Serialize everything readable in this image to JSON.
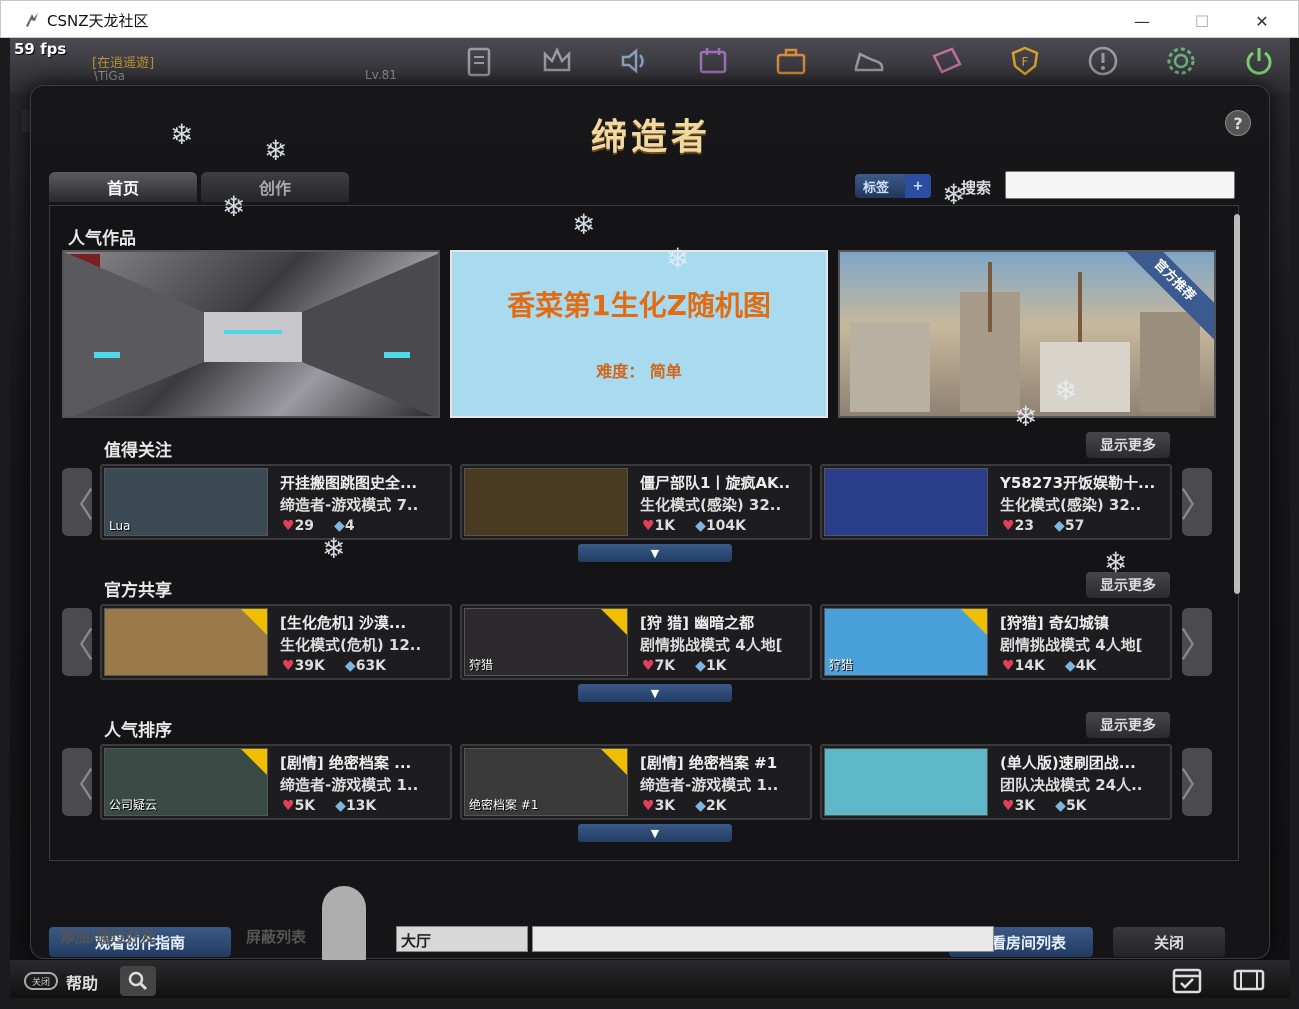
{
  "window": {
    "title": "CSNZ天龙社区",
    "minimize": "—",
    "maximize": "☐",
    "close": "✕"
  },
  "hud": {
    "fps": "59 fps",
    "status_tag": "[在逍遥遊]",
    "nickname": "\\TiGa",
    "level": "Lv.81"
  },
  "modal": {
    "title": "缔造者",
    "help": "?",
    "tabs": [
      {
        "label": "首页"
      },
      {
        "label": "创作"
      }
    ],
    "tag_button": "标签",
    "tag_plus": "+",
    "search_label": "搜索",
    "search_value": "",
    "popular": {
      "title": "人气作品",
      "featured_center_title": "香菜第1生化Z随机图",
      "featured_center_sub": "难度： 简单",
      "featured_right_ribbon": "官方推荐"
    },
    "sections": [
      {
        "title": "值得关注",
        "more": "显示更多",
        "cards": [
          {
            "title": "开挂搬图跳图史全...",
            "mode": "缔造者-游戏模式 7..",
            "likes": "29",
            "forks": "4",
            "thumb_label": "Lua",
            "thumb_color": "#3b4a55",
            "badge": false
          },
          {
            "title": "僵尸部队1丨旋疯AK..",
            "mode": "生化模式(感染) 32..",
            "likes": "1K",
            "forks": "104K",
            "thumb_label": "",
            "thumb_color": "#4a3a22",
            "badge": false
          },
          {
            "title": "Y58273开饭娱勒十...",
            "mode": "生化模式(感染) 32..",
            "likes": "23",
            "forks": "57",
            "thumb_label": "",
            "thumb_color": "#2a3e8a",
            "badge": false
          }
        ]
      },
      {
        "title": "官方共享",
        "more": "显示更多",
        "cards": [
          {
            "title": "[生化危机] 沙漠...",
            "mode": "生化模式(危机) 12..",
            "likes": "39K",
            "forks": "63K",
            "thumb_label": "",
            "thumb_color": "#9b7a4a",
            "badge": true
          },
          {
            "title": "[狩 猎] 幽暗之都",
            "mode": "剧情挑战模式 4人地[",
            "likes": "7K",
            "forks": "1K",
            "thumb_label": "狩猎",
            "thumb_color": "#2c2a2c",
            "badge": true
          },
          {
            "title": "[狩猎] 奇幻城镇",
            "mode": "剧情挑战模式 4人地[",
            "likes": "14K",
            "forks": "4K",
            "thumb_label": "狩猎",
            "thumb_color": "#4aa0d8",
            "badge": true
          }
        ]
      },
      {
        "title": "人气排序",
        "more": "显示更多",
        "cards": [
          {
            "title": "[剧情] 绝密档案 ...",
            "mode": "缔造者-游戏模式 1..",
            "likes": "5K",
            "forks": "13K",
            "thumb_label": "公司疑云",
            "thumb_color": "#3a4a44",
            "badge": true
          },
          {
            "title": "[剧情] 绝密档案 #1",
            "mode": "缔造者-游戏模式 1..",
            "likes": "3K",
            "forks": "2K",
            "thumb_label": "绝密档案 #1",
            "thumb_color": "#3a3a3a",
            "badge": true
          },
          {
            "title": "(单人版)速刷团战...",
            "mode": "团队决战模式 24人..",
            "likes": "3K",
            "forks": "5K",
            "thumb_label": "",
            "thumb_color": "#5fb8c8",
            "badge": false
          }
        ]
      }
    ],
    "guide_button": "观看创作指南",
    "roomlist_button": "查看房间列表",
    "close_button": "关闭"
  },
  "lobby": {
    "add_friend": "添加/通过好友",
    "block_list": "屏蔽列表",
    "channel": "大厅",
    "chat_value": ""
  },
  "bottombar": {
    "help_pill": "关闭",
    "help": "帮助"
  },
  "icons": {
    "top": [
      "clipboard-icon",
      "crown-icon",
      "speaker-icon",
      "calendar-icon",
      "briefcase-icon",
      "shoe-icon",
      "ticket-icon",
      "shield-icon",
      "alert-icon",
      "gear-icon",
      "power-icon"
    ],
    "top_colors": [
      "#9b9aa0",
      "#9b9aa0",
      "#8aa0c0",
      "#a070b8",
      "#d88a3a",
      "#9b9aa0",
      "#c070a0",
      "#d8a030",
      "#9b9aa0",
      "#6ab080",
      "#7ad070"
    ]
  }
}
